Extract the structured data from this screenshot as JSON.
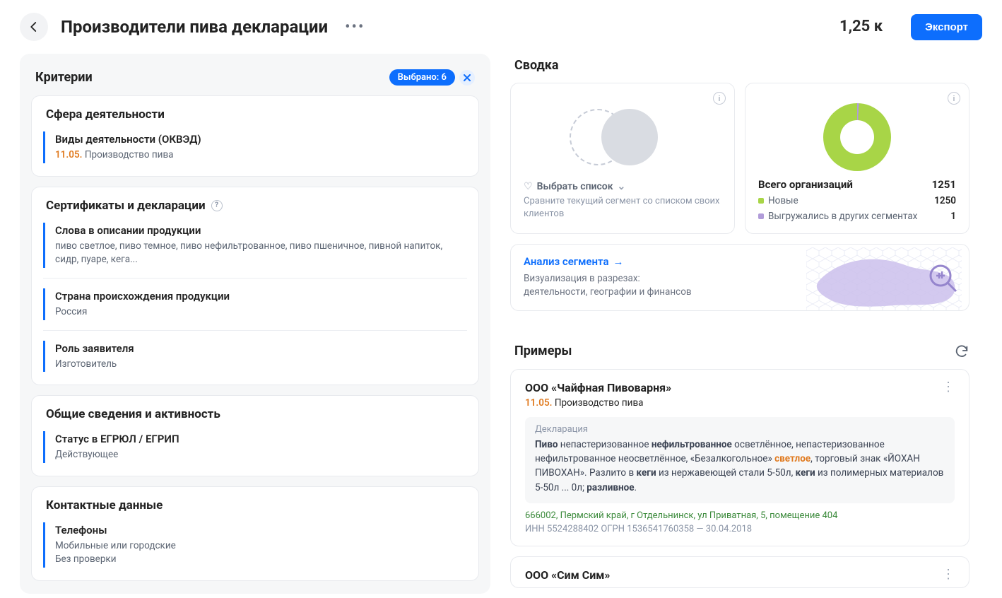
{
  "header": {
    "title": "Производители пива декларации",
    "count": "1,25 к",
    "export_label": "Экспорт"
  },
  "criteria": {
    "title": "Критерии",
    "selected_chip": "Выбрано: 6",
    "groups": [
      {
        "title": "Сфера деятельности",
        "items": [
          {
            "title": "Виды деятельности (ОКВЭД)",
            "code": "11.05.",
            "code_text": "Производство пива"
          }
        ]
      },
      {
        "title": "Сертификаты и декларации",
        "help": true,
        "items": [
          {
            "title": "Слова в описании продукции",
            "value": "пиво светлое, пиво темное, пиво нефильтрованное, пиво пшеничное, пивной напиток, сидр, пуаре, кега..."
          },
          {
            "title": "Страна происхождения продукции",
            "value": "Россия"
          },
          {
            "title": "Роль заявителя",
            "value": "Изготовитель"
          }
        ]
      },
      {
        "title": "Общие сведения и активность",
        "items": [
          {
            "title": "Статус в ЕГРЮЛ / ЕГРИП",
            "value": "Действующее"
          }
        ]
      },
      {
        "title": "Контактные данные",
        "items": [
          {
            "title": "Телефоны",
            "value": "Мобильные или городские",
            "value2": "Без проверки"
          }
        ]
      }
    ]
  },
  "summary": {
    "title": "Сводка",
    "compare": {
      "pick_label": "Выбрать список",
      "sub": "Сравните текущий сегмент со списком своих клиентов"
    },
    "stats": {
      "total_label": "Всего организаций",
      "total_value": "1251",
      "rows": [
        {
          "color": "green",
          "label": "Новые",
          "value": "1250"
        },
        {
          "color": "violet",
          "label": "Выгружались в других сегментах",
          "value": "1"
        }
      ]
    },
    "analysis": {
      "link": "Анализ сегмента",
      "sub1": "Визуализация в разрезах:",
      "sub2": "деятельности, географии и финансов"
    }
  },
  "examples": {
    "title": "Примеры",
    "items": [
      {
        "name": "ООО «Чайфная Пивоварня»",
        "code": "11.05.",
        "code_text": "Производство пива",
        "decl_label": "Декларация",
        "decl_html": "<b>Пиво</b> непастеризованное <b>нефильтрованное</b> осветлённое, непастеризованное нефильтрованное неосветлённое, «Безалкогольное» <span class='hl'>светлое</span>, торговый знак «ЙОХАН ПИВОХАН». Разлито в <b>кеги</b> из нержавеющей стали 5-50л, <b>кеги</b> из полимерных материалов 5-50л ... 0л; <b>разливное</b>.",
        "address": "666002, Пермский край, г Отдельнинск, ул Приватная, 5, помещение 404",
        "meta": "ИНН 5524288402    ОГРН 1536541760358 — 30.04.2018"
      },
      {
        "name": "ООО «Сим Сим»"
      }
    ]
  },
  "chart_data": {
    "type": "pie",
    "title": "Всего организаций",
    "total": 1251,
    "series": [
      {
        "name": "Новые",
        "value": 1250,
        "color": "#a8d547"
      },
      {
        "name": "Выгружались в других сегментах",
        "value": 1,
        "color": "#b19cd9"
      }
    ]
  }
}
